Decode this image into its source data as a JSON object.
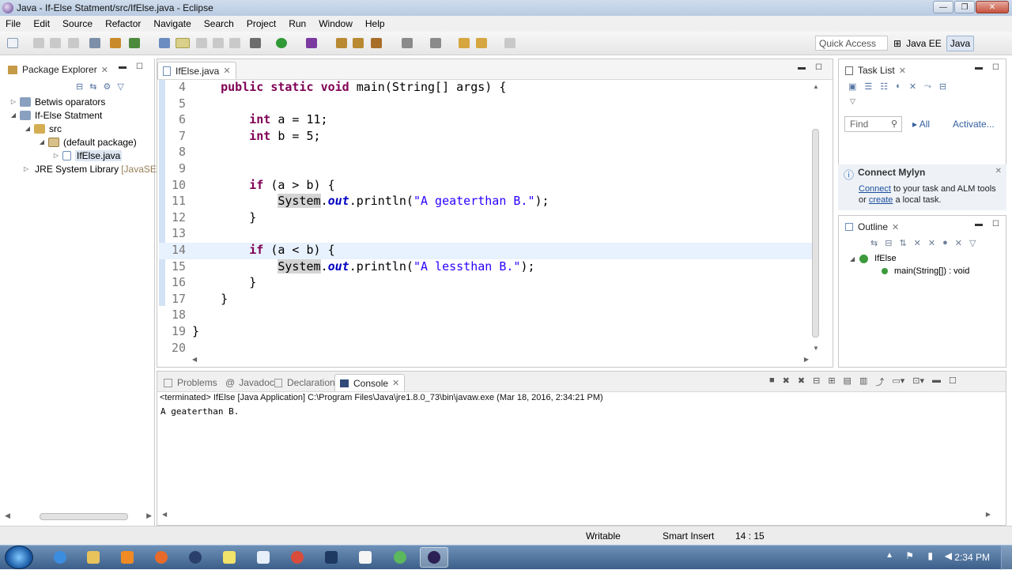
{
  "window": {
    "title": "Java - If-Else Statment/src/IfElse.java - Eclipse",
    "min_label": "—",
    "max_label": "❐",
    "close_label": "✕"
  },
  "menu": [
    "File",
    "Edit",
    "Source",
    "Refactor",
    "Navigate",
    "Search",
    "Project",
    "Run",
    "Window",
    "Help"
  ],
  "toolbar": {
    "quick_access": "Quick Access",
    "perspectives": [
      "Java EE",
      "Java"
    ]
  },
  "package_explorer": {
    "title": "Package Explorer",
    "tree": [
      {
        "label": "Betwis oparators",
        "depth": 0,
        "expanded": false
      },
      {
        "label": "If-Else Statment",
        "depth": 0,
        "expanded": true
      },
      {
        "label": "src",
        "depth": 1,
        "expanded": true
      },
      {
        "label": "(default package)",
        "depth": 2,
        "expanded": true
      },
      {
        "label": "IfElse.java",
        "depth": 3,
        "expanded": false
      },
      {
        "label": "JRE System Library",
        "suffix": "[JavaSE",
        "depth": 1,
        "expanded": false
      }
    ]
  },
  "editor": {
    "tab": "IfElse.java",
    "lines": [
      {
        "num": "4",
        "text": "    public static void main(String[] args) {"
      },
      {
        "num": "5",
        "text": ""
      },
      {
        "num": "6",
        "text": "        int a = 11;"
      },
      {
        "num": "7",
        "text": "        int b = 5;"
      },
      {
        "num": "8",
        "text": ""
      },
      {
        "num": "9",
        "text": ""
      },
      {
        "num": "10",
        "text": "        if (a > b) {"
      },
      {
        "num": "11",
        "text": "            System.out.println(\"A geaterthan B.\");"
      },
      {
        "num": "12",
        "text": "        }"
      },
      {
        "num": "13",
        "text": ""
      },
      {
        "num": "14",
        "text": "        if (a < b) {"
      },
      {
        "num": "15",
        "text": "            System.out.println(\"A lessthan B.\");"
      },
      {
        "num": "16",
        "text": "        }"
      },
      {
        "num": "17",
        "text": "    }"
      },
      {
        "num": "18",
        "text": ""
      },
      {
        "num": "19",
        "text": "}"
      },
      {
        "num": "20",
        "text": ""
      }
    ]
  },
  "console": {
    "tabs": [
      "Problems",
      "Javadoc",
      "Declaration",
      "Console"
    ],
    "active_tab": "Console",
    "status": "<terminated> IfElse [Java Application] C:\\Program Files\\Java\\jre1.8.0_73\\bin\\javaw.exe (Mar 18, 2016, 2:34:21 PM)",
    "output": "A geaterthan B."
  },
  "task_list": {
    "title": "Task List",
    "find_placeholder": "Find",
    "all_label": "All",
    "activate_label": "Activate..."
  },
  "mylyn": {
    "title": "Connect Mylyn",
    "connect_link": "Connect",
    "text1": " to your task and ALM tools",
    "or_text": "or ",
    "create_link": "create",
    "text2": " a local task."
  },
  "outline": {
    "title": "Outline",
    "class_name": "IfElse",
    "method": "main(String[]) : void"
  },
  "statusbar": {
    "writable": "Writable",
    "insert_mode": "Smart Insert",
    "position": "14 : 15"
  },
  "taskbar": {
    "time": "2:34 PM"
  },
  "colors": {
    "keyword": "#7f0055",
    "string": "#2a00ff",
    "field": "#0000c0",
    "current_line": "#e8f2fe"
  }
}
